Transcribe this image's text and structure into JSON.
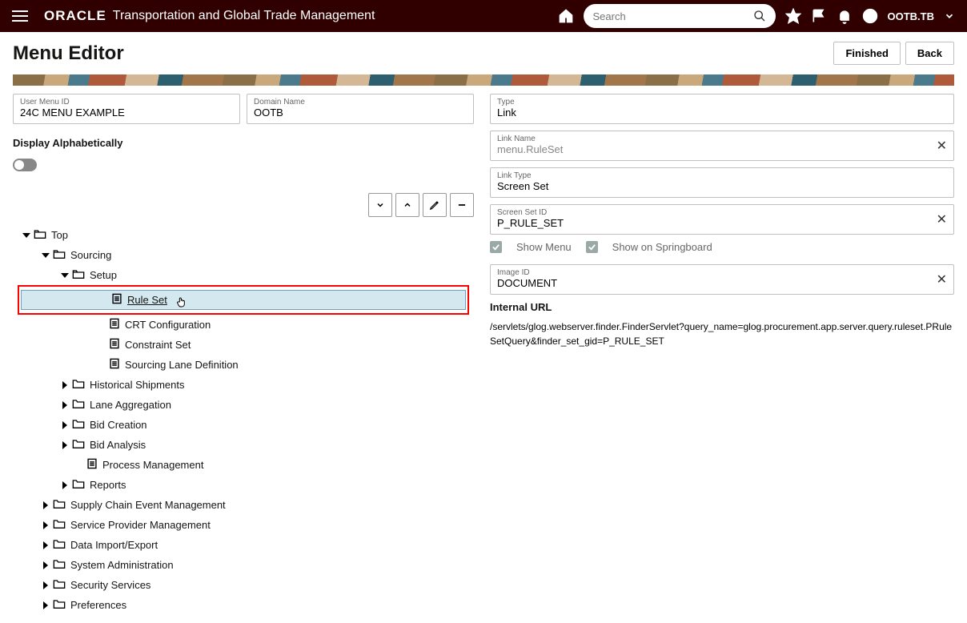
{
  "header": {
    "logo": "ORACLE",
    "app_title": "Transportation and Global Trade Management",
    "search_placeholder": "Search",
    "user": "OOTB.TB"
  },
  "page": {
    "title": "Menu Editor",
    "finished": "Finished",
    "back": "Back"
  },
  "left": {
    "user_menu_id_label": "User Menu ID",
    "user_menu_id_value": "24C MENU EXAMPLE",
    "domain_name_label": "Domain Name",
    "domain_name_value": "OOTB",
    "display_alpha": "Display Alphabetically"
  },
  "tree": {
    "top": "Top",
    "sourcing": "Sourcing",
    "setup": "Setup",
    "rule_set": "Rule Set",
    "crt_config": "CRT Configuration",
    "constraint_set": "Constraint Set",
    "sourcing_lane": "Sourcing Lane Definition",
    "historical": "Historical Shipments",
    "lane_agg": "Lane Aggregation",
    "bid_creation": "Bid Creation",
    "bid_analysis": "Bid Analysis",
    "process_mgmt": "Process Management",
    "reports": "Reports",
    "supply_chain": "Supply Chain Event Management",
    "service_provider": "Service Provider Management",
    "data_import": "Data Import/Export",
    "system_admin": "System Administration",
    "security": "Security Services",
    "preferences": "Preferences"
  },
  "right": {
    "type_label": "Type",
    "type_value": "Link",
    "link_name_label": "Link Name",
    "link_name_value": "menu.RuleSet",
    "link_type_label": "Link Type",
    "link_type_value": "Screen Set",
    "screen_set_label": "Screen Set ID",
    "screen_set_value": "P_RULE_SET",
    "show_menu": "Show Menu",
    "show_springboard": "Show on Springboard",
    "image_id_label": "Image ID",
    "image_id_value": "DOCUMENT",
    "internal_url_label": "Internal URL",
    "internal_url_value": "/servlets/glog.webserver.finder.FinderServlet?query_name=glog.procurement.app.server.query.ruleset.PRuleSetQuery&finder_set_gid=P_RULE_SET"
  }
}
